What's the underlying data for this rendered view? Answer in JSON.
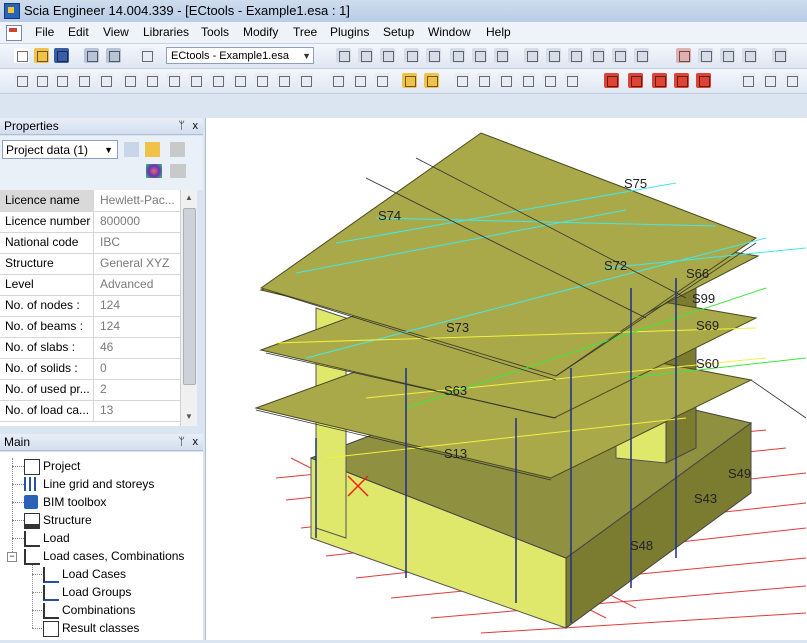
{
  "window": {
    "title": "Scia Engineer 14.004.339 - [ECtools - Example1.esa : 1]"
  },
  "menu": [
    "File",
    "Edit",
    "View",
    "Libraries",
    "Tools",
    "Modify",
    "Tree",
    "Plugins",
    "Setup",
    "Window",
    "Help"
  ],
  "toolbar": {
    "document_selector": "ECtools - Example1.esa"
  },
  "properties": {
    "title": "Properties",
    "pin_glyph": "p",
    "close_glyph": "x",
    "selector_value": "Project data (1)",
    "rows": [
      {
        "key": "Licence name",
        "value": "Hewlett-Pac..."
      },
      {
        "key": "Licence number",
        "value": "800000"
      },
      {
        "key": "National code",
        "value": "IBC"
      },
      {
        "key": "Structure",
        "value": "General XYZ"
      },
      {
        "key": "Level",
        "value": "Advanced"
      },
      {
        "key": "No. of nodes :",
        "value": "124"
      },
      {
        "key": "No. of beams :",
        "value": "124"
      },
      {
        "key": "No. of slabs :",
        "value": "46"
      },
      {
        "key": "No. of solids :",
        "value": "0"
      },
      {
        "key": "No. of used pr...",
        "value": "2"
      },
      {
        "key": "No. of load ca...",
        "value": "13"
      }
    ]
  },
  "main": {
    "title": "Main",
    "items": [
      {
        "label": "Project",
        "icon": "project-icon"
      },
      {
        "label": "Line grid and storeys",
        "icon": "grid-icon"
      },
      {
        "label": "BIM toolbox",
        "icon": "bim-toolbox-icon"
      },
      {
        "label": "Structure",
        "icon": "structure-icon"
      },
      {
        "label": "Load",
        "icon": "load-icon"
      },
      {
        "label": "Load cases, Combinations",
        "icon": "load-cases-icon"
      },
      {
        "label": "Load Cases",
        "icon": "load-case-icon"
      },
      {
        "label": "Load Groups",
        "icon": "load-group-icon"
      },
      {
        "label": "Combinations",
        "icon": "combination-icon"
      },
      {
        "label": "Result classes",
        "icon": "result-class-icon"
      }
    ]
  },
  "model": {
    "slab_labels": [
      "S75",
      "S74",
      "S72",
      "S73",
      "S60",
      "S63",
      "S66",
      "S13",
      "S49",
      "S43",
      "S48",
      "S99",
      "S69"
    ]
  }
}
